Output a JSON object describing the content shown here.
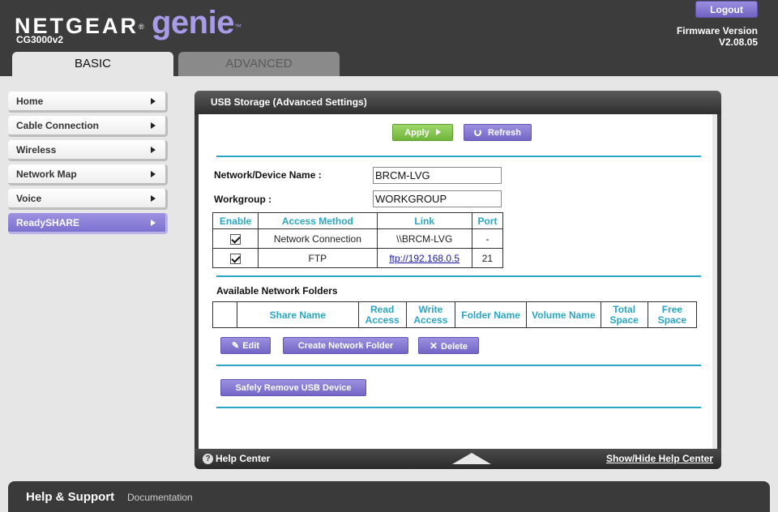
{
  "header": {
    "brand_netgear": "NETGEAR",
    "brand_genie": "genie",
    "model": "CG3000v2",
    "logout_label": "Logout",
    "firmware_label": "Firmware Version",
    "firmware_value": "V2.08.05"
  },
  "tabs": [
    {
      "label": "BASIC",
      "active": true
    },
    {
      "label": "ADVANCED",
      "active": false
    }
  ],
  "sidebar": {
    "items": [
      {
        "label": "Home",
        "active": false
      },
      {
        "label": "Cable Connection",
        "active": false
      },
      {
        "label": "Wireless",
        "active": false
      },
      {
        "label": "Network Map",
        "active": false
      },
      {
        "label": "Voice",
        "active": false
      },
      {
        "label": "ReadySHARE",
        "active": true
      }
    ]
  },
  "panel": {
    "title": "USB Storage (Advanced Settings)",
    "apply_label": "Apply",
    "refresh_label": "Refresh",
    "device_name_label": "Network/Device Name :",
    "device_name_value": "BRCM-LVG",
    "workgroup_label": "Workgroup :",
    "workgroup_value": "WORKGROUP",
    "access_table": {
      "headers": [
        "Enable",
        "Access Method",
        "Link",
        "Port"
      ],
      "rows": [
        {
          "enabled": true,
          "method": "Network Connection",
          "link": "\\\\BRCM-LVG",
          "link_is_url": false,
          "port": "-"
        },
        {
          "enabled": true,
          "method": "FTP",
          "link": "ftp://192.168.0.5",
          "link_is_url": true,
          "port": "21"
        }
      ]
    },
    "folders_title": "Available Network Folders",
    "folders_table": {
      "headers": [
        "",
        "Share Name",
        "Read Access",
        "Write Access",
        "Folder Name",
        "Volume Name",
        "Total Space",
        "Free Space"
      ]
    },
    "edit_label": "Edit",
    "create_folder_label": "Create Network Folder",
    "delete_label": "Delete",
    "safely_remove_label": "Safely Remove USB Device",
    "help_center_label": "Help Center",
    "show_hide_help_label": "Show/Hide Help Center"
  },
  "footer": {
    "help_support": "Help & Support",
    "documentation": "Documentation"
  },
  "colors": {
    "accent_purple": "#7c70cf",
    "apply_green": "#6fb53a",
    "table_header_blue": "#2aa6c2",
    "header_bg": "#3c3c3c"
  }
}
